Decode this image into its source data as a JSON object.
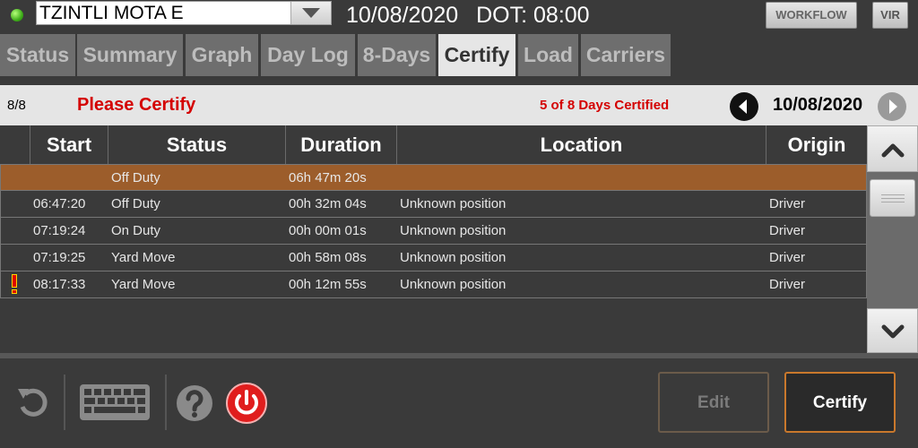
{
  "header": {
    "driver_name": "TZINTLI MOTA E",
    "date": "10/08/2020",
    "dot_time": "DOT: 08:00",
    "workflow_label": "WORKFLOW",
    "vir_label": "VIR"
  },
  "tabs": [
    {
      "label": "Status"
    },
    {
      "label": "Summary"
    },
    {
      "label": "Graph"
    },
    {
      "label": "Day Log"
    },
    {
      "label": "8-Days"
    },
    {
      "label": "Certify",
      "active": true
    },
    {
      "label": "Load"
    },
    {
      "label": "Carriers"
    }
  ],
  "certify": {
    "page_indicator": "8/8",
    "title": "Please Certify",
    "count_text": "5 of 8 Days Certified",
    "current_date": "10/08/2020"
  },
  "table": {
    "columns": [
      "Start",
      "Status",
      "Duration",
      "Location",
      "Origin"
    ],
    "rows": [
      {
        "start": "",
        "status": "Off Duty",
        "duration": "06h 47m 20s",
        "location": "",
        "origin": "",
        "selected": true,
        "warning": false
      },
      {
        "start": "06:47:20",
        "status": "Off Duty",
        "duration": "00h 32m 04s",
        "location": "Unknown position",
        "origin": "Driver",
        "selected": false,
        "warning": false
      },
      {
        "start": "07:19:24",
        "status": "On Duty",
        "duration": "00h 00m 01s",
        "location": "Unknown position",
        "origin": "Driver",
        "selected": false,
        "warning": false
      },
      {
        "start": "07:19:25",
        "status": "Yard Move",
        "duration": "00h 58m 08s",
        "location": "Unknown position",
        "origin": "Driver",
        "selected": false,
        "warning": false
      },
      {
        "start": "08:17:33",
        "status": "Yard Move",
        "duration": "00h 12m 55s",
        "location": "Unknown position",
        "origin": "Driver",
        "selected": false,
        "warning": true
      }
    ]
  },
  "footer": {
    "edit_label": "Edit",
    "certify_label": "Certify"
  },
  "colors": {
    "selected_row": "#9c5d2b",
    "alert_text": "#d40000",
    "active_tab": "#e6e6e6",
    "certify_border": "#c9782c",
    "status_ok": "#3fae1a"
  },
  "icons": [
    "status-dot-icon",
    "dropdown-arrow-icon",
    "prev-day-icon",
    "next-day-icon",
    "warning-icon",
    "scroll-up-icon",
    "scroll-down-icon",
    "refresh-icon",
    "keyboard-icon",
    "help-icon",
    "power-icon"
  ]
}
